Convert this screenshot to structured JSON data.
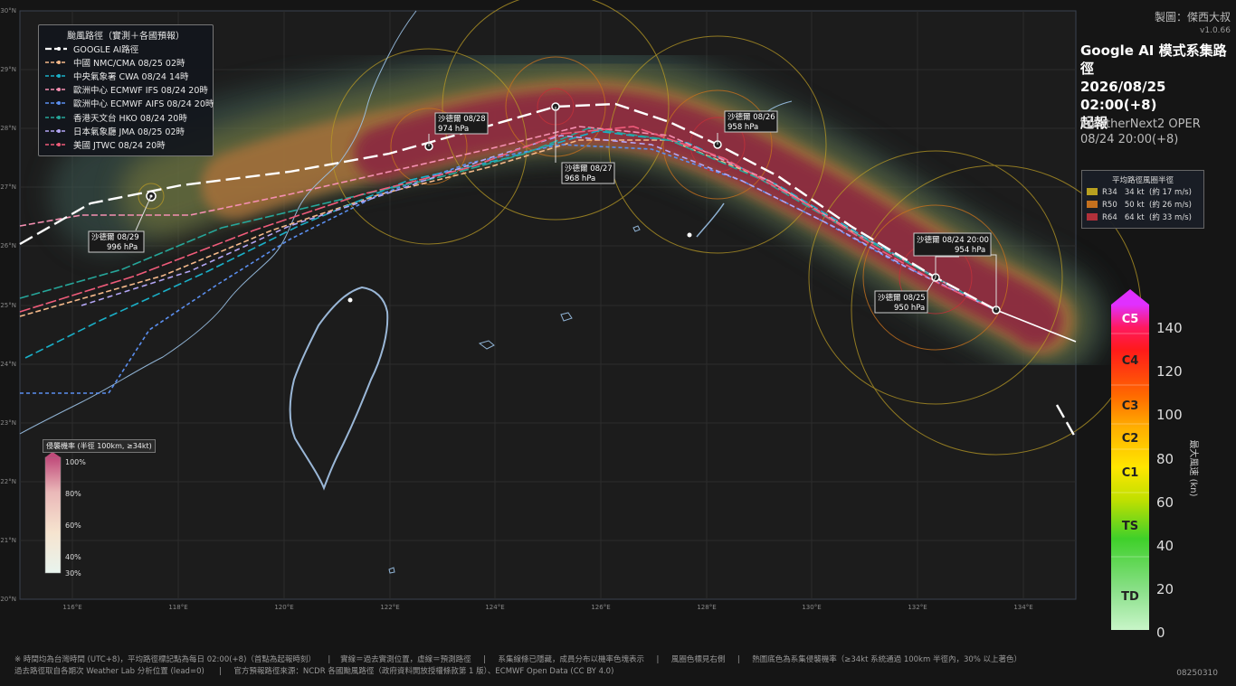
{
  "credit": {
    "author": "製圖：傑西大叔",
    "version": "v1.0.66"
  },
  "heading": {
    "line1": "Google AI 模式系集路徑",
    "line2": "2026/08/25 02:00(+8)",
    "line3": "起報"
  },
  "model": {
    "line1": "WeatherNext2 OPER",
    "line2": "08/24 20:00(+8)"
  },
  "legend": {
    "title": "颱風路徑（實測＋各國預報）",
    "items": [
      {
        "label": "GOOGLE AI路徑",
        "color": "#ffffff"
      },
      {
        "label": "中國 NMC/CMA  08/25 02時",
        "color": "#f5b98a"
      },
      {
        "label": "中央氣象署 CWA  08/24 14時",
        "color": "#1ab0c8"
      },
      {
        "label": "歐洲中心 ECMWF IFS  08/24 20時",
        "color": "#f48fb1"
      },
      {
        "label": "歐洲中心 ECMWF AIFS  08/24 20時",
        "color": "#5b8ff0"
      },
      {
        "label": "香港天文台 HKO  08/24 20時",
        "color": "#26a69a"
      },
      {
        "label": "日本氣象廳 JMA  08/25 02時",
        "color": "#b3a6f5"
      },
      {
        "label": "美國 JTWC  08/24 20時",
        "color": "#ef5b7a"
      }
    ]
  },
  "wind_radius": {
    "title": "平均路徑風圈半徑",
    "items": [
      {
        "label": "R34   34 kt  (約 17 m/s)",
        "color": "#b8a020"
      },
      {
        "label": "R50   50 kt  (約 26 m/s)",
        "color": "#c4701e"
      },
      {
        "label": "R64   64 kt  (約 33 m/s)",
        "color": "#b0303a"
      }
    ]
  },
  "prob_legend": {
    "title": "侵襲機率 (半徑 100km, ≥34kt)",
    "ticks": [
      "100%",
      "80%",
      "60%",
      "40%",
      "30%"
    ]
  },
  "intensity_bar": {
    "categories": [
      "C5",
      "C4",
      "C3",
      "C2",
      "C1",
      "TS",
      "TD"
    ],
    "ticks": [
      "140",
      "120",
      "100",
      "80",
      "60",
      "40",
      "20",
      "0"
    ],
    "axis_label": "最大風速 (kn)"
  },
  "map": {
    "lat_labels": [
      "30°N",
      "29°N",
      "28°N",
      "27°N",
      "26°N",
      "25°N",
      "24°N",
      "23°N",
      "22°N",
      "21°N",
      "20°N"
    ],
    "lon_labels": [
      "116°E",
      "118°E",
      "120°E",
      "122°E",
      "124°E",
      "126°E",
      "128°E",
      "130°E",
      "132°E",
      "134°E"
    ],
    "lon_range": [
      115,
      135
    ],
    "lat_range": [
      20,
      30
    ],
    "track_labels": [
      {
        "name": "沙德爾 08/28",
        "pressure": "974 hPa"
      },
      {
        "name": "沙德爾 08/26",
        "pressure": "958 hPa"
      },
      {
        "name": "沙德爾 08/27",
        "pressure": "968 hPa"
      },
      {
        "name": "沙德爾 08/29",
        "pressure": "996 hPa"
      },
      {
        "name": "沙德爾 08/24 20:00",
        "pressure": "954 hPa"
      },
      {
        "name": "沙德爾 08/25",
        "pressure": "950 hPa"
      }
    ]
  },
  "footer": {
    "line1": "※ 時間均為台灣時間 (UTC+8)，平均路徑標記點為每日 02:00(+8)（首點為起報時刻）     |    實線＝過去實測位置，虛線＝預測路徑     |     系集線條已隱藏，成員分布以機率色塊表示     |     風圈色標見右側     |     熱圖底色為系集侵襲機率（≥34kt 系統通過 100km 半徑內，30% 以上著色）",
    "line2": "過去路徑取自各期次 Weather Lab 分析位置 (lead=0)      |     官方預報路徑來源：NCDR 各國颱風路徑（政府資料開放授權條款第 1 版）、ECMWF Open Data (CC BY 4.0)",
    "code": "08250310"
  }
}
